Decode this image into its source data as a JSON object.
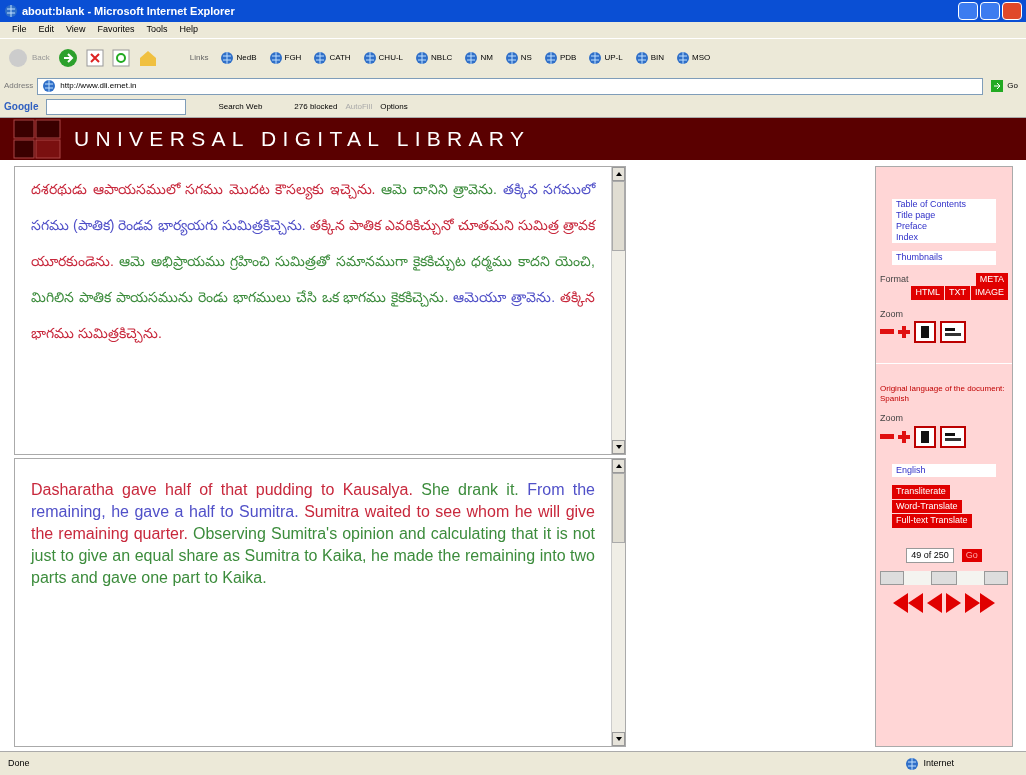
{
  "window": {
    "title": "about:blank - Microsoft Internet Explorer"
  },
  "menu": [
    "File",
    "Edit",
    "View",
    "Favorites",
    "Tools",
    "Help"
  ],
  "toolbar": {
    "back": "Back",
    "links_label": "Links",
    "links": [
      "NedB",
      "FGH",
      "CATH",
      "CHU-L",
      "NBLC",
      "NM",
      "NS",
      "PDB",
      "UP-L",
      "BIN",
      "MSO"
    ]
  },
  "address": {
    "label": "Address",
    "value": "http://www.dli.ernet.in",
    "go": "Go"
  },
  "google_bar": {
    "logo": "Google",
    "search": "Search Web",
    "blocked": "276 blocked",
    "autofill": "AutoFill",
    "options": "Options"
  },
  "banner": {
    "title": "UNIVERSAL DIGITAL LIBRARY"
  },
  "original_text": [
    {
      "text": "దశరథుడు ఆపాయసములో సగము మొదట కౌసల్యకు ఇచ్చెను.",
      "color": "#c8283c"
    },
    {
      "text": "ఆమె దానిని త్రావెను.",
      "color": "#3c8c3c"
    },
    {
      "text": "తక్కిన సగములో సగము (పాతిక) రెండవ భార్యయగు సుమిత్రకిచ్చెను.",
      "color": "#5050c8"
    },
    {
      "text": "తక్కిన పాతిక ఎవరికిచ్చునో చూతమని సుమిత్ర త్రావక యూరకుండెను.",
      "color": "#c8283c"
    },
    {
      "text": "ఆమె అభిప్రాయము గ్రహించి సుమిత్రతో సమానముగా కైకకిచ్చుట ధర్మము కాదని యెంచి, మిగిలిన పాతిక పాయసమును రెండు భాగములు చేసి ఒక భాగము కైకకిచ్చెను.",
      "color": "#3c8c3c"
    },
    {
      "text": "ఆమెయూ త్రావెను.",
      "color": "#5050c8"
    },
    {
      "text": "తక్కిన భాగము సుమిత్రకిచ్చెను.",
      "color": "#c8283c"
    }
  ],
  "translation": [
    {
      "text": "Dasharatha gave half of that pudding to Kausalya.",
      "color": "#c8283c"
    },
    {
      "text": "She drank it.",
      "color": "#3c8c3c"
    },
    {
      "text": "From the remaining, he gave a half to Sumitra.",
      "color": "#5050c8"
    },
    {
      "text": "Sumitra waited to see whom he will give the remaining quarter.",
      "color": "#c8283c"
    },
    {
      "text": "Observing Sumitra's opinion and calculating that it is not just to give an equal share as Sumitra to Kaika, he made the remaining into two parts and gave one part to Kaika.",
      "color": "#3c8c3c"
    }
  ],
  "sidebar": {
    "contents": [
      "Table of Contents",
      "Title page",
      "Preface",
      "Index"
    ],
    "thumbnails": "Thumbnails",
    "format_label": "Format",
    "formats": [
      "META",
      "HTML",
      "TXT",
      "IMAGE"
    ],
    "zoom_label": "Zoom",
    "language_note": "Original language of the document: Spanish",
    "zoom_label_2": "Zoom",
    "language": "English",
    "actions": [
      "Transliterate",
      "Word-Translate",
      "Full-text Translate"
    ],
    "page": "49 of 250",
    "go": "Go"
  },
  "status_bar": {
    "left": "Done",
    "right": "Internet"
  }
}
